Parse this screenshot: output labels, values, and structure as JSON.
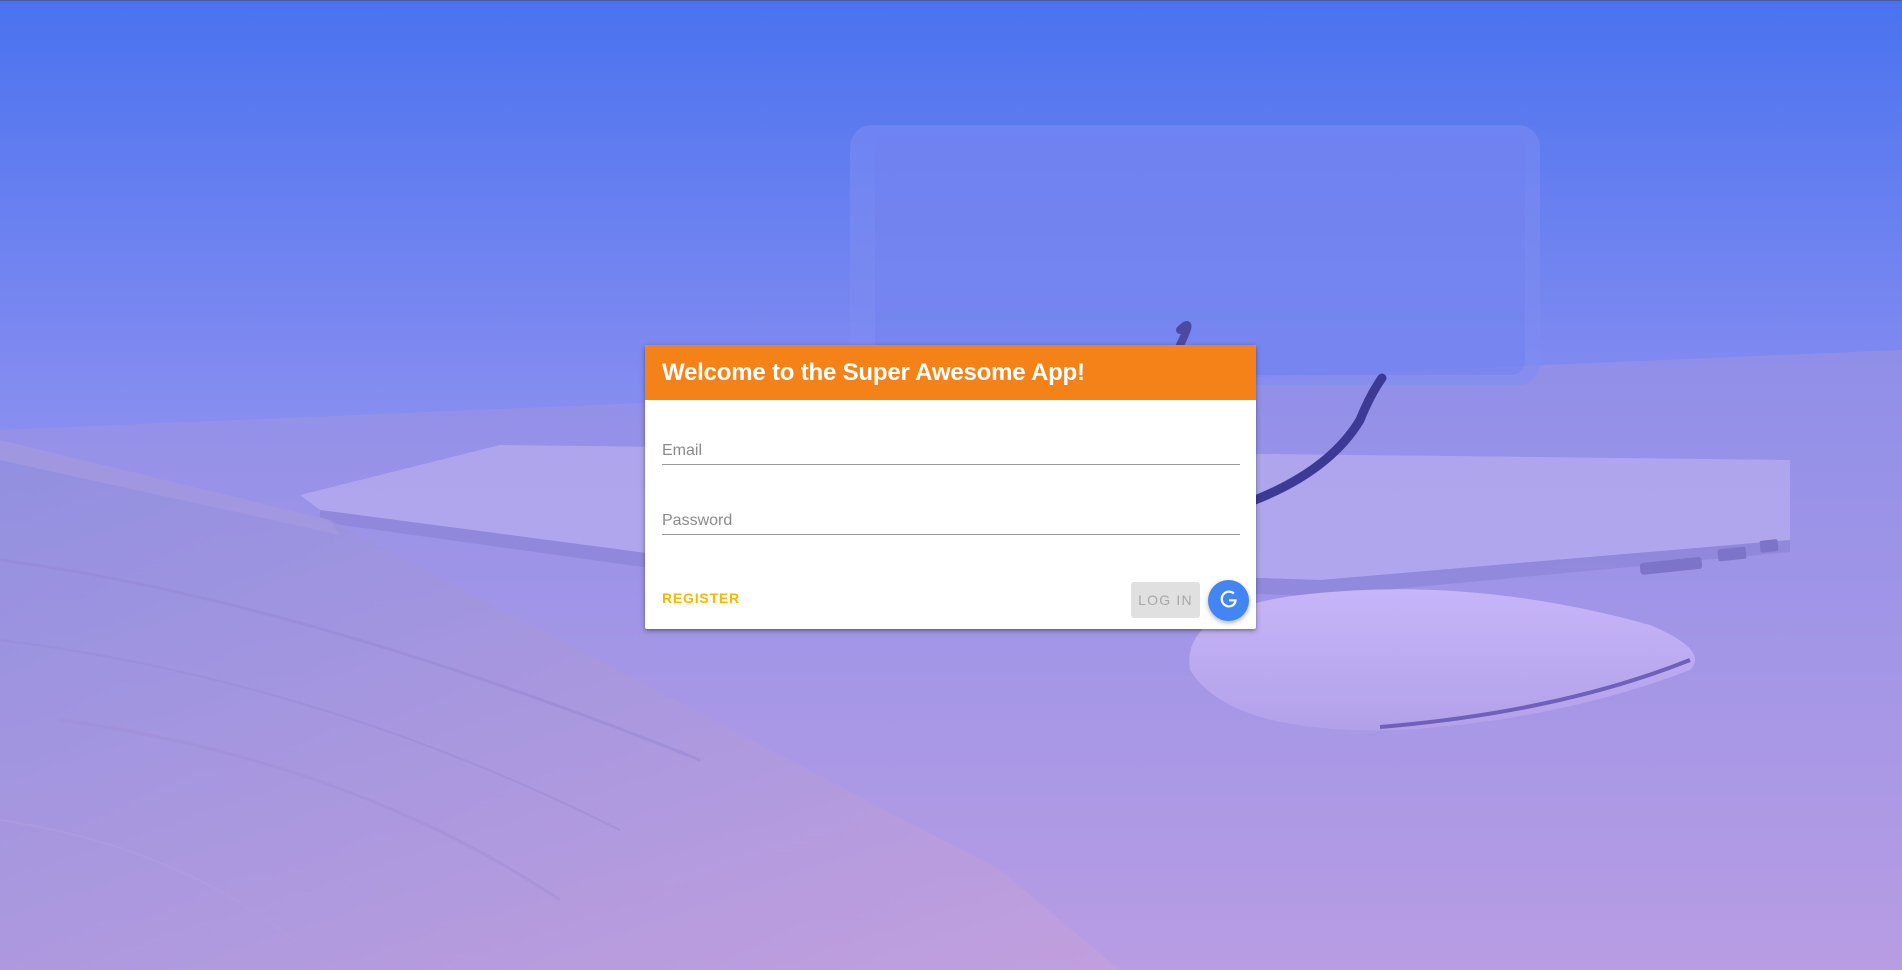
{
  "app": {
    "title": "Welcome to the Super Awesome App!"
  },
  "login_form": {
    "email_placeholder": "Email",
    "email_value": "",
    "password_placeholder": "Password",
    "password_value": "",
    "register_label": "REGISTER",
    "login_label": "LOG IN",
    "google_icon": "google-g-icon"
  },
  "colors": {
    "header": "#f58218",
    "register": "#f5b800",
    "google": "#4285f4",
    "bg_top": "#4a72f0",
    "bg_bottom": "#dca8e6"
  }
}
